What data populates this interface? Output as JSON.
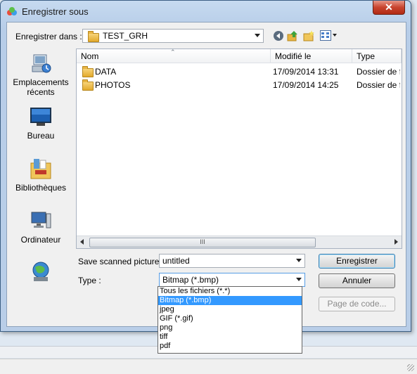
{
  "window": {
    "title": "Enregistrer sous",
    "close_label": "✕"
  },
  "toolbar": {
    "save_in_label": "Enregistrer dans :",
    "current_folder": "TEST_GRH",
    "icons": [
      "back-icon",
      "up-folder-icon",
      "new-folder-icon",
      "view-menu-icon"
    ]
  },
  "places": [
    {
      "id": "recent",
      "label_line1": "Emplacements",
      "label_line2": "récents",
      "icon": "recent-places-icon"
    },
    {
      "id": "desktop",
      "label_line1": "Bureau",
      "label_line2": "",
      "icon": "desktop-icon"
    },
    {
      "id": "libraries",
      "label_line1": "Bibliothèques",
      "label_line2": "",
      "icon": "libraries-icon"
    },
    {
      "id": "computer",
      "label_line1": "Ordinateur",
      "label_line2": "",
      "icon": "computer-icon"
    },
    {
      "id": "network",
      "label_line1": "",
      "label_line2": "",
      "icon": "network-icon"
    }
  ],
  "files": {
    "columns": [
      "Nom",
      "Modifié le",
      "Type"
    ],
    "rows": [
      {
        "name": "DATA",
        "modified": "17/09/2014 13:31",
        "type": "Dossier de f"
      },
      {
        "name": "PHOTOS",
        "modified": "17/09/2014 14:25",
        "type": "Dossier de f"
      }
    ],
    "scroll_thumb": "III"
  },
  "form": {
    "filename_label": "Save scanned picture",
    "filename_value": "untitled",
    "type_label": "Type :",
    "type_value": "Bitmap (*.bmp)"
  },
  "buttons": {
    "save": "Enregistrer",
    "cancel": "Annuler",
    "codepage": "Page de code..."
  },
  "type_options": [
    "Tous les fichiers (*.*)",
    "Bitmap (*.bmp)",
    "jpeg",
    "GIF (*.gif)",
    "png",
    "tiff",
    "pdf"
  ],
  "colors": {
    "selection": "#3399ff",
    "close_button": "#c8442e"
  }
}
